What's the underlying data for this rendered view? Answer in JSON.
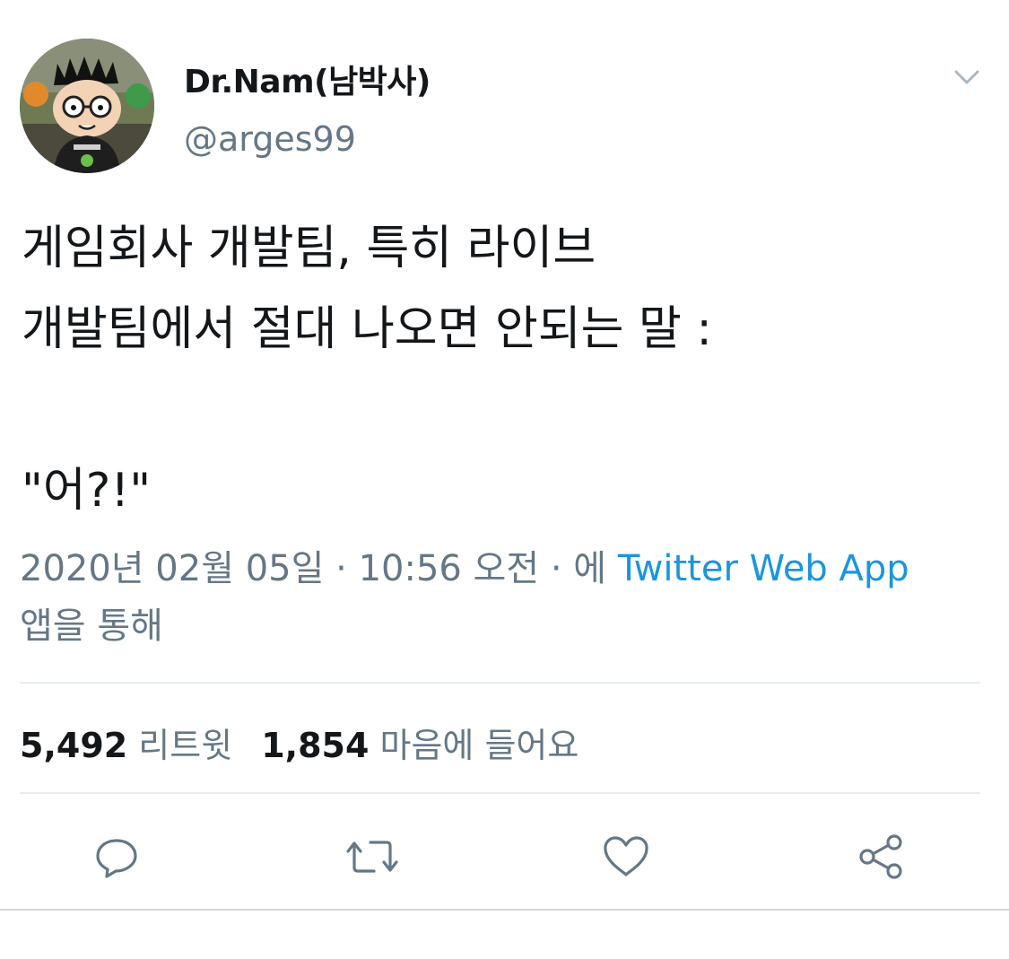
{
  "user": {
    "display_name": "Dr.Nam(남박사)",
    "handle": "@arges99"
  },
  "tweet": {
    "text": "게임회사 개발팀, 특히 라이브\n개발팀에서 절대 나오면 안되는 말 :\n\n\"어?!\"",
    "timestamp": "2020년 02월 05일 · 10:56 오전 · 에 ",
    "source_link": "Twitter Web App",
    "source_suffix": " 앱을 통해"
  },
  "stats": {
    "retweets_count": "5,492",
    "retweets_label": "리트윗",
    "likes_count": "1,854",
    "likes_label": "마음에 들어요"
  },
  "icons": {
    "menu": "chevron-down-icon",
    "reply": "reply-icon",
    "retweet": "retweet-icon",
    "like": "heart-icon",
    "share": "share-icon"
  },
  "colors": {
    "link": "#1b95e0",
    "secondary_text": "#657786",
    "primary_text": "#14171a",
    "divider": "#e6ecf0"
  }
}
